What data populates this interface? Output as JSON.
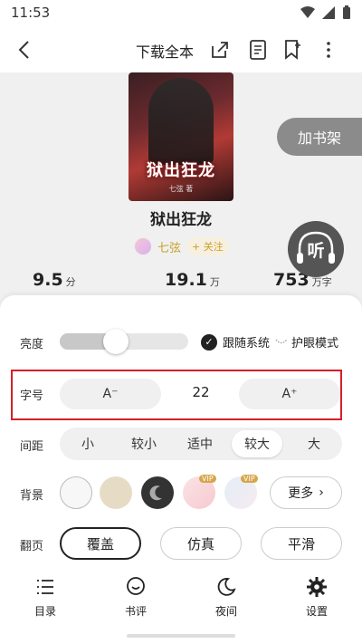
{
  "status_bar": {
    "time": "11:53"
  },
  "nav": {
    "title": "下载全本"
  },
  "book": {
    "cover_title": "狱出狂龙",
    "cover_author": "七弦 著",
    "name": "狱出狂龙",
    "author": "七弦",
    "follow_label": "+ 关注",
    "stats": [
      {
        "value": "9.5",
        "unit": "分"
      },
      {
        "value": "19.1",
        "unit": "万"
      },
      {
        "value": "753",
        "unit": "万字"
      }
    ]
  },
  "floating": {
    "add_shelf": "加书架",
    "listen": "听"
  },
  "settings": {
    "brightness": {
      "label": "亮度",
      "level": 0.42,
      "follow_system": "跟随系统",
      "eye_mode": "护眼模式"
    },
    "font_size": {
      "label": "字号",
      "decrease": "A⁻",
      "value": "22",
      "increase": "A⁺"
    },
    "spacing": {
      "label": "间距",
      "options": [
        "小",
        "较小",
        "适中",
        "较大",
        "大"
      ],
      "selected": "较大"
    },
    "background": {
      "label": "背景",
      "more": "更多",
      "vip_badge": "VIP"
    },
    "page_turn": {
      "label": "翻页",
      "options": [
        "覆盖",
        "仿真",
        "平滑"
      ],
      "selected": "覆盖"
    }
  },
  "bottom_nav": [
    {
      "label": "目录"
    },
    {
      "label": "书评"
    },
    {
      "label": "夜间"
    },
    {
      "label": "设置"
    }
  ]
}
